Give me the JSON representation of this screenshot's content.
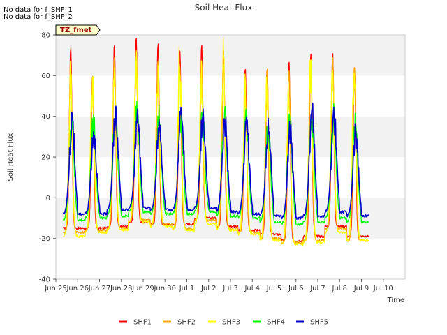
{
  "notes": [
    "No data for f_SHF_1",
    "No data for f_SHF_2"
  ],
  "tag_label": "TZ_fmet",
  "chart_data": {
    "type": "line",
    "title": "Soil Heat Flux",
    "xlabel": "Time",
    "ylabel": "Soil Heat Flux",
    "ylim": [
      -40,
      80
    ],
    "yticks": [
      -40,
      -20,
      0,
      20,
      40,
      60,
      80
    ],
    "xlim_days": [
      0,
      16
    ],
    "xtick_labels": [
      "Jun 25",
      "Jun 26",
      "Jun 27",
      "Jun 28",
      "Jun 29",
      "Jun 30",
      "Jul 1",
      "Jul 2",
      "Jul 3",
      "Jul 4",
      "Jul 5",
      "Jul 6",
      "Jul 7",
      "Jul 8",
      "Jul 9",
      "Jul 10"
    ],
    "grid": "horizontal bands",
    "legend_position": "bottom",
    "x_start": "Jun 25 08:00",
    "x_end": "Jul 9 08:00",
    "series": [
      {
        "name": "SHF1",
        "color": "#ff0000",
        "daily_max": [
          74,
          60,
          76,
          79,
          76,
          73,
          75,
          73,
          64,
          64,
          67,
          71,
          71,
          62
        ],
        "daily_min": [
          -15,
          -15,
          -14,
          -12,
          -13,
          -13,
          -10,
          -14,
          -16,
          -18,
          -21,
          -19,
          -14,
          -19
        ]
      },
      {
        "name": "SHF2",
        "color": "#ffa500",
        "daily_max": [
          63,
          60,
          69,
          70,
          68,
          65,
          67,
          66,
          50,
          63,
          63,
          68,
          69,
          65
        ],
        "daily_min": [
          -17,
          -16,
          -15,
          -11,
          -13,
          -15,
          -11,
          -15,
          -17,
          -20,
          -22,
          -21,
          -15,
          -21
        ]
      },
      {
        "name": "SHF3",
        "color": "#ffff00",
        "daily_max": [
          56,
          55,
          60,
          64,
          57,
          64,
          56,
          66,
          51,
          56,
          53,
          60,
          58,
          63
        ],
        "daily_min": [
          -19,
          -17,
          -16,
          -12,
          -14,
          -16,
          -13,
          -16,
          -18,
          -21,
          -23,
          -22,
          -17,
          -21
        ]
      },
      {
        "name": "SHF4",
        "color": "#00ff00",
        "daily_max": [
          38,
          38,
          42,
          44,
          40,
          40,
          40,
          40,
          38,
          38,
          38,
          40,
          39,
          38
        ],
        "daily_min": [
          -11,
          -10,
          -9,
          -7,
          -8,
          -8,
          -7,
          -9,
          -10,
          -12,
          -13,
          -12,
          -10,
          -12
        ]
      },
      {
        "name": "SHF5",
        "color": "#0000cc",
        "daily_max": [
          38,
          33,
          41,
          38,
          36,
          41,
          40,
          37,
          35,
          35,
          32,
          42,
          40,
          32
        ],
        "daily_min": [
          -8,
          -8,
          -6,
          -5,
          -6,
          -6,
          -5,
          -7,
          -8,
          -9,
          -10,
          -9,
          -7,
          -9
        ]
      }
    ]
  }
}
